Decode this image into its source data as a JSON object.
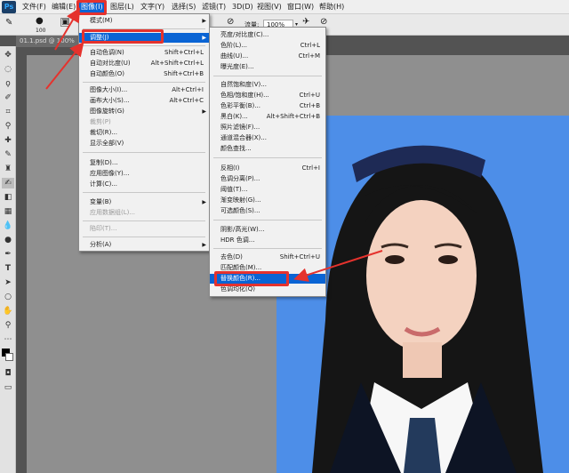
{
  "app": {
    "logo": "Ps"
  },
  "menubar": {
    "items": [
      "文件(F)",
      "编辑(E)",
      "图像(I)",
      "图层(L)",
      "文字(Y)",
      "选择(S)",
      "滤镜(T)",
      "3D(D)",
      "视图(V)",
      "窗口(W)",
      "帮助(H)"
    ]
  },
  "options": {
    "flow_label": "流量:",
    "flow_value": "100%",
    "brush_size": "100"
  },
  "document": {
    "tab": "01.1.psd @ 100%"
  },
  "image_menu": {
    "items": [
      {
        "label": "模式(M)",
        "shortcut": "",
        "sub": true
      },
      {
        "label": "调整(J)",
        "shortcut": "",
        "sub": true,
        "hl": true
      },
      {
        "label": "自动色调(N)",
        "shortcut": "Shift+Ctrl+L"
      },
      {
        "label": "自动对比度(U)",
        "shortcut": "Alt+Shift+Ctrl+L"
      },
      {
        "label": "自动颜色(O)",
        "shortcut": "Shift+Ctrl+B"
      },
      {
        "label": "图像大小(I)...",
        "shortcut": "Alt+Ctrl+I"
      },
      {
        "label": "画布大小(S)...",
        "shortcut": "Alt+Ctrl+C"
      },
      {
        "label": "图像旋转(G)",
        "shortcut": "",
        "sub": true
      },
      {
        "label": "裁剪(P)",
        "shortcut": "",
        "disabled": true
      },
      {
        "label": "裁切(R)...",
        "shortcut": ""
      },
      {
        "label": "显示全部(V)",
        "shortcut": ""
      },
      {
        "label": "复制(D)...",
        "shortcut": ""
      },
      {
        "label": "应用图像(Y)...",
        "shortcut": ""
      },
      {
        "label": "计算(C)...",
        "shortcut": ""
      },
      {
        "label": "变量(B)",
        "shortcut": "",
        "sub": true
      },
      {
        "label": "应用数据组(L)...",
        "shortcut": "",
        "disabled": true
      },
      {
        "label": "陷印(T)...",
        "shortcut": "",
        "disabled": true
      },
      {
        "label": "分析(A)",
        "shortcut": "",
        "sub": true
      }
    ]
  },
  "adjust_menu": {
    "items": [
      {
        "label": "亮度/对比度(C)...",
        "shortcut": ""
      },
      {
        "label": "色阶(L)...",
        "shortcut": "Ctrl+L"
      },
      {
        "label": "曲线(U)...",
        "shortcut": "Ctrl+M"
      },
      {
        "label": "曝光度(E)...",
        "shortcut": ""
      },
      {
        "label": "自然饱和度(V)...",
        "shortcut": ""
      },
      {
        "label": "色相/饱和度(H)...",
        "shortcut": "Ctrl+U"
      },
      {
        "label": "色彩平衡(B)...",
        "shortcut": "Ctrl+B"
      },
      {
        "label": "黑白(K)...",
        "shortcut": "Alt+Shift+Ctrl+B"
      },
      {
        "label": "照片滤镜(F)...",
        "shortcut": ""
      },
      {
        "label": "通道混合器(X)...",
        "shortcut": ""
      },
      {
        "label": "颜色查找...",
        "shortcut": ""
      },
      {
        "label": "反相(I)",
        "shortcut": "Ctrl+I"
      },
      {
        "label": "色调分离(P)...",
        "shortcut": ""
      },
      {
        "label": "阈值(T)...",
        "shortcut": ""
      },
      {
        "label": "渐变映射(G)...",
        "shortcut": ""
      },
      {
        "label": "可选颜色(S)...",
        "shortcut": ""
      },
      {
        "label": "阴影/高光(W)...",
        "shortcut": ""
      },
      {
        "label": "HDR 色调...",
        "shortcut": ""
      },
      {
        "label": "去色(D)",
        "shortcut": "Shift+Ctrl+U"
      },
      {
        "label": "匹配颜色(M)...",
        "shortcut": ""
      },
      {
        "label": "替换颜色(R)...",
        "shortcut": "",
        "hl": true
      },
      {
        "label": "色调均化(Q)",
        "shortcut": ""
      }
    ]
  },
  "colors": {
    "accent": "#0a64d4",
    "annotation": "#e5322d",
    "photo_bg": "#4d8ee8"
  }
}
